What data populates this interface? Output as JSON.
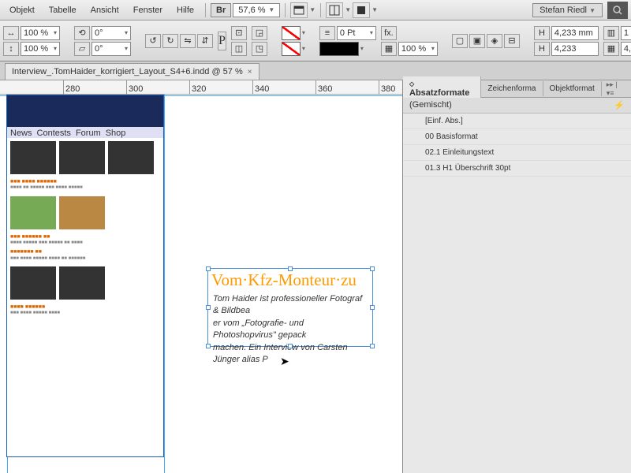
{
  "menu": {
    "items": [
      "Objekt",
      "Tabelle",
      "Ansicht",
      "Fenster",
      "Hilfe"
    ],
    "br": "Br",
    "zoom": "57,6 %"
  },
  "user": "Stefan Riedl",
  "control": {
    "scale_x": "100 %",
    "scale_y": "100 %",
    "rot": "0°",
    "shear": "0°",
    "stroke_pt": "0 Pt",
    "pct": "100 %",
    "dim": "4,233 mm",
    "dim2": "4,233",
    "cols": "1"
  },
  "tab": {
    "name": "Interview_.TomHaider_korrigiert_Layout_S4+6.indd @ 57 %"
  },
  "ruler": [
    "280",
    "300",
    "320",
    "340",
    "360",
    "380"
  ],
  "headline": "Vom·Kfz-Monteur·zu",
  "body_l1": "Tom Haider ist professioneller Fotograf & Bildbea",
  "body_l2": "er vom „Fotografie- und Photoshopvirus\" gepack",
  "body_l3": "machen. Ein Interview von Carsten Jünger alias P",
  "panel": {
    "tabs": [
      "Absatzformate",
      "Zeichenforma",
      "Objektformat"
    ],
    "head": "(Gemischt)",
    "styles": [
      "[Einf. Abs.]",
      "00 Basisformat",
      "02.1 Einleitungstext",
      "01.3 H1 Überschrift 30pt"
    ]
  },
  "webnav": [
    "News",
    "Contests",
    "Forum",
    "Shop"
  ]
}
